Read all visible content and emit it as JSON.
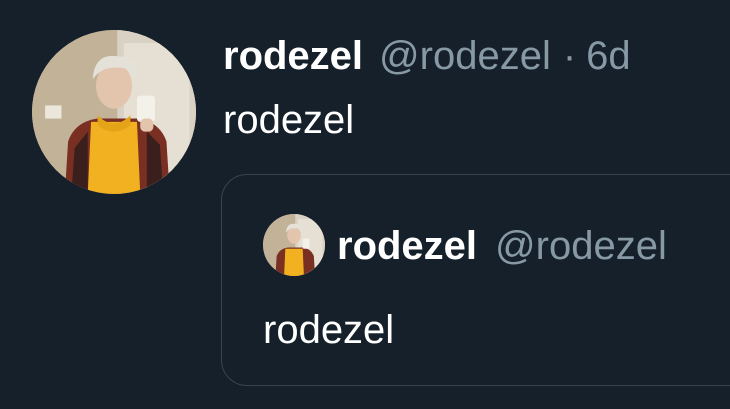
{
  "tweet": {
    "display_name": "rodezel",
    "handle": "@rodezel",
    "separator": "·",
    "time": "6d",
    "text": "rodezel",
    "avatar": "profile-photo"
  },
  "quoted_tweet": {
    "display_name": "rodezel",
    "handle": "@rodezel",
    "text": "rodezel",
    "avatar": "profile-photo"
  },
  "colors": {
    "background": "#15202b",
    "primary_text": "#ffffff",
    "secondary_text": "#8899a6",
    "border": "#38444d"
  }
}
